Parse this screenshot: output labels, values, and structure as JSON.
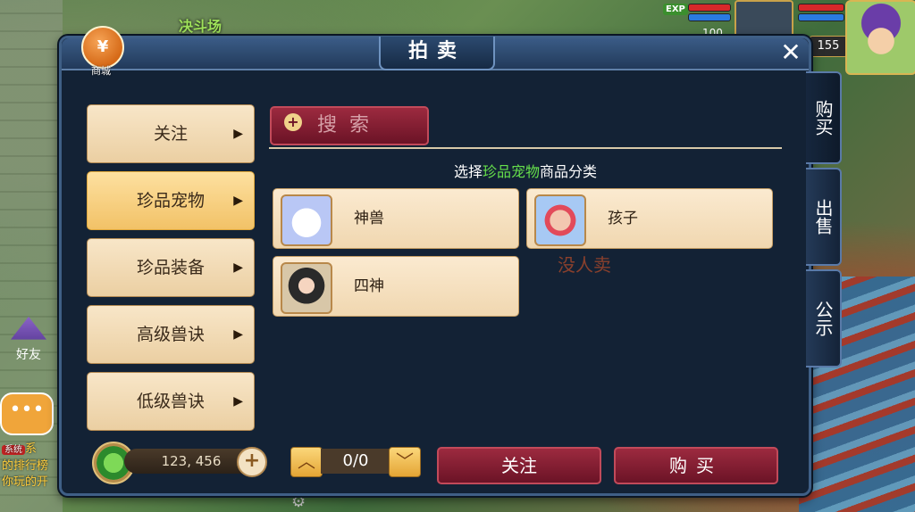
{
  "hud": {
    "arena_label": "决斗场",
    "exp_badge": "EXP",
    "pet_level": "100",
    "player_level": "155"
  },
  "window": {
    "title": "拍卖",
    "close_symbol": "✕",
    "mall": {
      "symbol": "¥",
      "label": "商城"
    }
  },
  "categories": [
    {
      "label": "关注"
    },
    {
      "label": "珍品宠物"
    },
    {
      "label": "珍品装备"
    },
    {
      "label": "高级兽诀"
    },
    {
      "label": "低级兽诀"
    }
  ],
  "arrow_symbol": "▶",
  "search": {
    "label": "搜索",
    "icon": "magnifier-icon"
  },
  "subtitle": {
    "prefix": "选择",
    "highlight": "珍品宠物",
    "suffix": "商品分类"
  },
  "items": [
    {
      "name": "神兽"
    },
    {
      "name": "孩子"
    },
    {
      "name": "四神"
    }
  ],
  "empty_text": "没人卖",
  "money": {
    "value": "123, 456",
    "plus": "+"
  },
  "pager": {
    "up": "︿",
    "down": "﹀",
    "count": "0/0"
  },
  "actions": {
    "follow": "关注",
    "buy": "购买"
  },
  "side_tabs": [
    {
      "label": "购买"
    },
    {
      "label": "出售"
    },
    {
      "label": "公示"
    }
  ],
  "left_panel": {
    "friend_label": "好友",
    "chat_symbol": "•••",
    "sys_tag": "系统",
    "sys_line1": "系",
    "sys_line2": "的排行榜",
    "sys_line3": "你玩的开"
  },
  "colors": {
    "highlight": "#66e04b",
    "panel": "#132235",
    "button_red": "#9c2a3f"
  }
}
